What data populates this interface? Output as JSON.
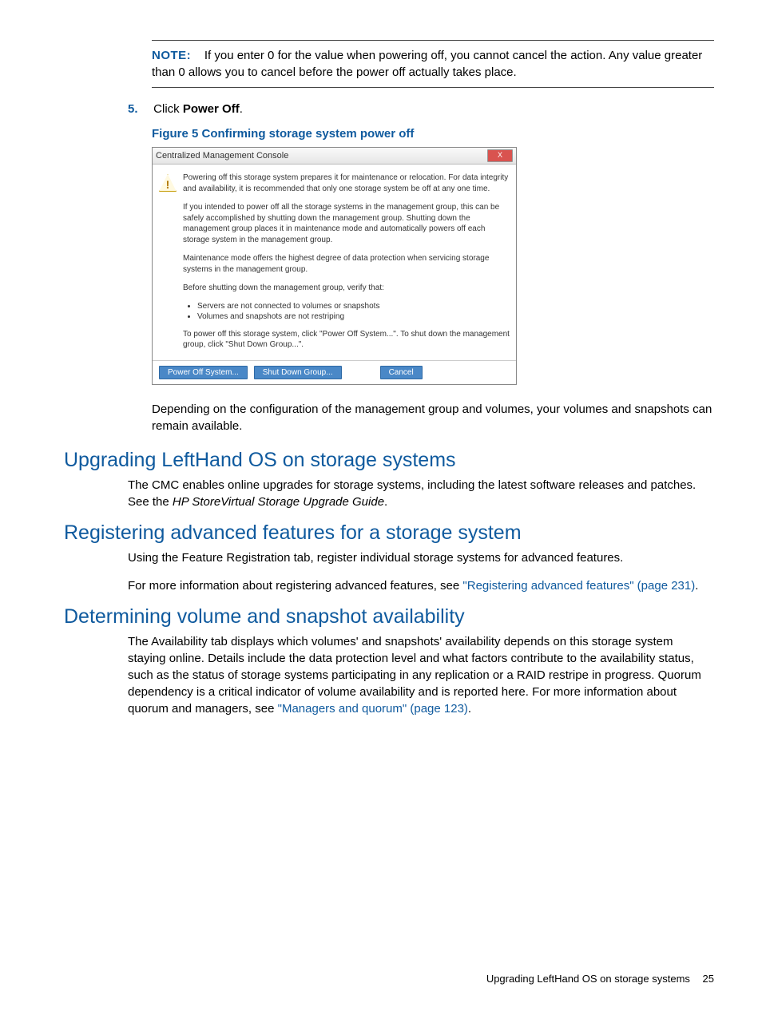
{
  "note": {
    "label": "NOTE:",
    "text": "If you enter 0 for the value when powering off, you cannot cancel the action. Any value greater than 0 allows you to cancel before the power off actually takes place."
  },
  "step5": {
    "num": "5.",
    "pre": "Click ",
    "bold": "Power Off",
    "post": "."
  },
  "figure": {
    "caption": "Figure 5 Confirming storage system power off"
  },
  "dialog": {
    "title": "Centralized Management Console",
    "close": "X",
    "warn_icon": "!",
    "p1": "Powering off this storage system prepares it for maintenance or relocation. For data integrity and availability, it is recommended that only one storage system be off at any one time.",
    "p2": "If you intended to power off all the storage systems in the management group, this can be safely accomplished by shutting down the management group. Shutting down the management group places it in maintenance mode and automatically powers off each storage system in the management group.",
    "p3": "Maintenance mode offers the highest degree of data protection when servicing storage systems in the management group.",
    "p4": "Before shutting down the management group, verify that:",
    "bullets": [
      "Servers are not connected to volumes or snapshots",
      "Volumes and snapshots are not restriping"
    ],
    "p5": "To power off this storage system, click \"Power Off System...\". To shut down the management group, click \"Shut Down Group...\".",
    "btn_power": "Power Off System...",
    "btn_shut": "Shut Down Group...",
    "btn_cancel": "Cancel"
  },
  "after_figure": "Depending on the configuration of the management group and volumes, your volumes and snapshots can remain available.",
  "sections": {
    "upgrade": {
      "heading": "Upgrading LeftHand OS on storage systems",
      "p1_a": "The CMC enables online upgrades for storage systems, including the latest software releases and patches. See the ",
      "p1_italic": "HP StoreVirtual Storage Upgrade Guide",
      "p1_b": "."
    },
    "register": {
      "heading": "Registering advanced features for a storage system",
      "p1": "Using the Feature Registration tab, register individual storage systems for advanced features.",
      "p2_a": "For more information about registering advanced features, see ",
      "p2_link": "\"Registering advanced features\" (page 231)",
      "p2_b": "."
    },
    "determine": {
      "heading": "Determining volume and snapshot availability",
      "p1_a": "The Availability tab displays which volumes' and snapshots' availability depends on this storage system staying online. Details include the data protection level and what factors contribute to the availability status, such as the status of storage systems participating in any replication or a RAID restripe in progress. Quorum dependency is a critical indicator of volume availability and is reported here. For more information about quorum and managers, see ",
      "p1_link": "\"Managers and quorum\" (page 123)",
      "p1_b": "."
    }
  },
  "footer": {
    "text": "Upgrading LeftHand OS on storage systems",
    "page": "25"
  }
}
